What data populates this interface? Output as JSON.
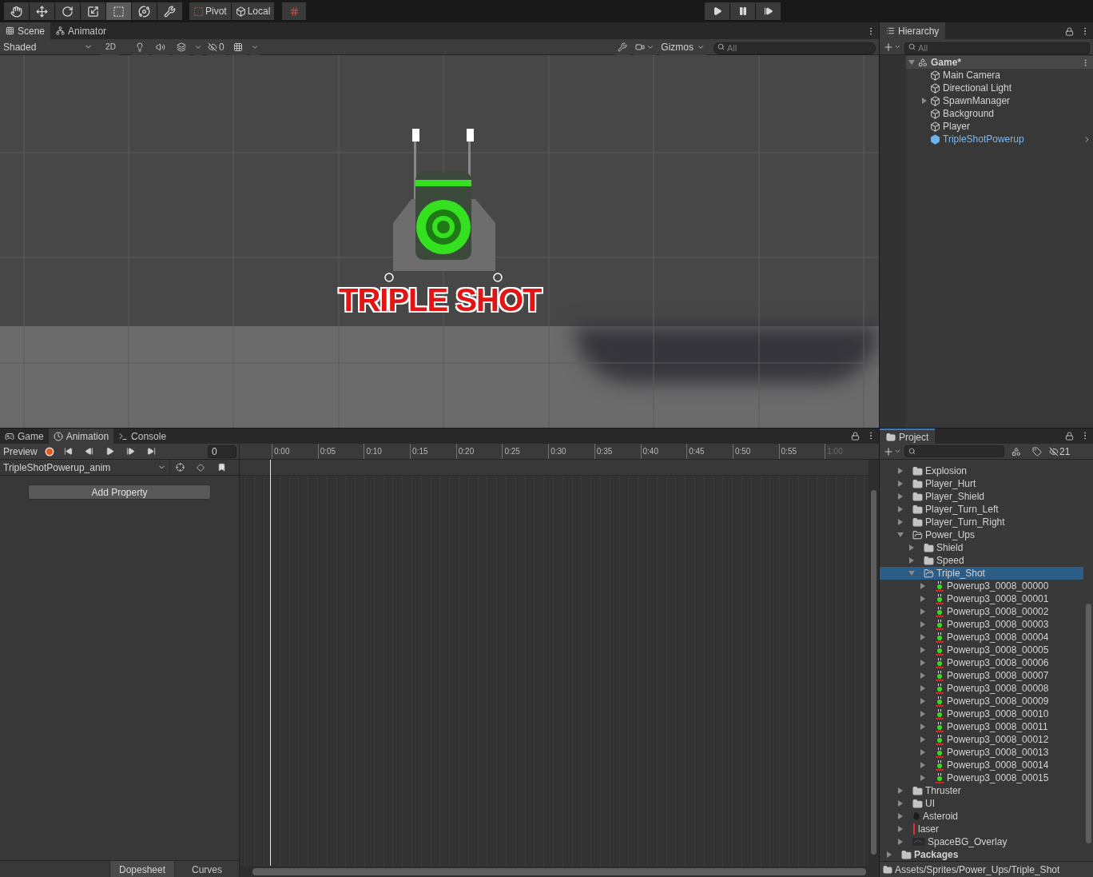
{
  "toolbar": {
    "tools": [
      {
        "kind": "hand",
        "selected": false
      },
      {
        "kind": "move",
        "selected": false
      },
      {
        "kind": "rotate",
        "selected": false
      },
      {
        "kind": "scale",
        "selected": false
      },
      {
        "kind": "rect",
        "selected": true
      },
      {
        "kind": "transform",
        "selected": false
      },
      {
        "kind": "custom",
        "selected": false
      }
    ],
    "pivot": "Pivot",
    "local": "Local",
    "play_controls": [
      {
        "kind": "play",
        "selected": false
      },
      {
        "kind": "pause",
        "selected": false
      },
      {
        "kind": "step",
        "selected": false
      }
    ]
  },
  "scene": {
    "tabs": [
      {
        "kind": "scene",
        "label": "Scene",
        "selected": true
      },
      {
        "kind": "animator",
        "label": "Animator",
        "selected": false
      }
    ],
    "shading": "Shaded",
    "mode_2d": "2D",
    "hidden_count": "0",
    "gizmos": "Gizmos",
    "search": {
      "placeholder": "All"
    },
    "sprite_label": "TRIPLE SHOT"
  },
  "hierarchy": {
    "title": "Hierarchy",
    "search": {
      "placeholder": "All"
    },
    "scene": "Game*",
    "items": [
      {
        "label": "Main Camera",
        "selected": false,
        "expandable": false
      },
      {
        "label": "Directional Light",
        "selected": false,
        "expandable": false
      },
      {
        "label": "SpawnManager",
        "selected": false,
        "expandable": true
      },
      {
        "label": "Background",
        "selected": false,
        "expandable": false
      },
      {
        "label": "Player",
        "selected": false,
        "expandable": false
      },
      {
        "label": "TripleShotPowerup",
        "selected": true,
        "expandable": false
      }
    ]
  },
  "animation": {
    "tabs": [
      {
        "kind": "game",
        "label": "Game",
        "selected": false
      },
      {
        "kind": "animation",
        "label": "Animation",
        "selected": true
      },
      {
        "kind": "console",
        "label": "Console",
        "selected": false
      }
    ],
    "preview": "Preview",
    "frame": "0",
    "clip": "TripleShotPowerup_anim",
    "add_property": "Add Property",
    "ruler": [
      {
        "label": "0:00",
        "disabled": false
      },
      {
        "label": "0:05",
        "disabled": false
      },
      {
        "label": "0:10",
        "disabled": false
      },
      {
        "label": "0:15",
        "disabled": false
      },
      {
        "label": "0:20",
        "disabled": false
      },
      {
        "label": "0:25",
        "disabled": false
      },
      {
        "label": "0:30",
        "disabled": false
      },
      {
        "label": "0:35",
        "disabled": false
      },
      {
        "label": "0:40",
        "disabled": false
      },
      {
        "label": "0:45",
        "disabled": false
      },
      {
        "label": "0:50",
        "disabled": false
      },
      {
        "label": "0:55",
        "disabled": false
      },
      {
        "label": "1:00",
        "disabled": true
      }
    ],
    "views": [
      {
        "label": "Dopesheet",
        "selected": true
      },
      {
        "label": "Curves",
        "selected": false
      }
    ]
  },
  "project": {
    "title": "Project",
    "hidden_count": "21",
    "tree": [
      {
        "kind": "folder",
        "label": "Explosion",
        "expanded": false,
        "selected": false
      },
      {
        "kind": "folder",
        "label": "Player_Hurt",
        "expanded": false,
        "selected": false
      },
      {
        "kind": "folder",
        "label": "Player_Shield",
        "expanded": false,
        "selected": false
      },
      {
        "kind": "folder",
        "label": "Player_Turn_Left",
        "expanded": false,
        "selected": false
      },
      {
        "kind": "folder",
        "label": "Player_Turn_Right",
        "expanded": false,
        "selected": false
      },
      {
        "kind": "folder",
        "label": "Power_Ups",
        "expanded": true,
        "selected": false,
        "children": [
          {
            "kind": "folder",
            "label": "Shield",
            "expanded": false,
            "selected": false
          },
          {
            "kind": "folder",
            "label": "Speed",
            "expanded": false,
            "selected": false
          },
          {
            "kind": "folder",
            "label": "Triple_Shot",
            "expanded": true,
            "selected": true,
            "children": [
              {
                "kind": "powerup",
                "label": "Powerup3_0008_00000",
                "expanded": false,
                "selected": false
              },
              {
                "kind": "powerup",
                "label": "Powerup3_0008_00001",
                "expanded": false,
                "selected": false
              },
              {
                "kind": "powerup",
                "label": "Powerup3_0008_00002",
                "expanded": false,
                "selected": false
              },
              {
                "kind": "powerup",
                "label": "Powerup3_0008_00003",
                "expanded": false,
                "selected": false
              },
              {
                "kind": "powerup",
                "label": "Powerup3_0008_00004",
                "expanded": false,
                "selected": false
              },
              {
                "kind": "powerup",
                "label": "Powerup3_0008_00005",
                "expanded": false,
                "selected": false
              },
              {
                "kind": "powerup",
                "label": "Powerup3_0008_00006",
                "expanded": false,
                "selected": false
              },
              {
                "kind": "powerup",
                "label": "Powerup3_0008_00007",
                "expanded": false,
                "selected": false
              },
              {
                "kind": "powerup",
                "label": "Powerup3_0008_00008",
                "expanded": false,
                "selected": false
              },
              {
                "kind": "powerup",
                "label": "Powerup3_0008_00009",
                "expanded": false,
                "selected": false
              },
              {
                "kind": "powerup",
                "label": "Powerup3_0008_00010",
                "expanded": false,
                "selected": false
              },
              {
                "kind": "powerup",
                "label": "Powerup3_0008_00011",
                "expanded": false,
                "selected": false
              },
              {
                "kind": "powerup",
                "label": "Powerup3_0008_00012",
                "expanded": false,
                "selected": false
              },
              {
                "kind": "powerup",
                "label": "Powerup3_0008_00013",
                "expanded": false,
                "selected": false
              },
              {
                "kind": "powerup",
                "label": "Powerup3_0008_00014",
                "expanded": false,
                "selected": false
              },
              {
                "kind": "powerup",
                "label": "Powerup3_0008_00015",
                "expanded": false,
                "selected": false
              }
            ]
          }
        ]
      },
      {
        "kind": "folder",
        "label": "Thruster",
        "expanded": false,
        "selected": false
      },
      {
        "kind": "folder",
        "label": "UI",
        "expanded": false,
        "selected": false
      },
      {
        "kind": "asteroid",
        "label": "Asteroid",
        "expanded": false,
        "selected": false
      },
      {
        "kind": "laser",
        "label": "laser",
        "expanded": false,
        "selected": false
      },
      {
        "kind": "background",
        "label": "SpaceBG_Overlay",
        "expanded": false,
        "selected": false
      }
    ],
    "packages": {
      "label": "Packages"
    },
    "path": "Assets/Sprites/Power_Ups/Triple_Shot"
  }
}
